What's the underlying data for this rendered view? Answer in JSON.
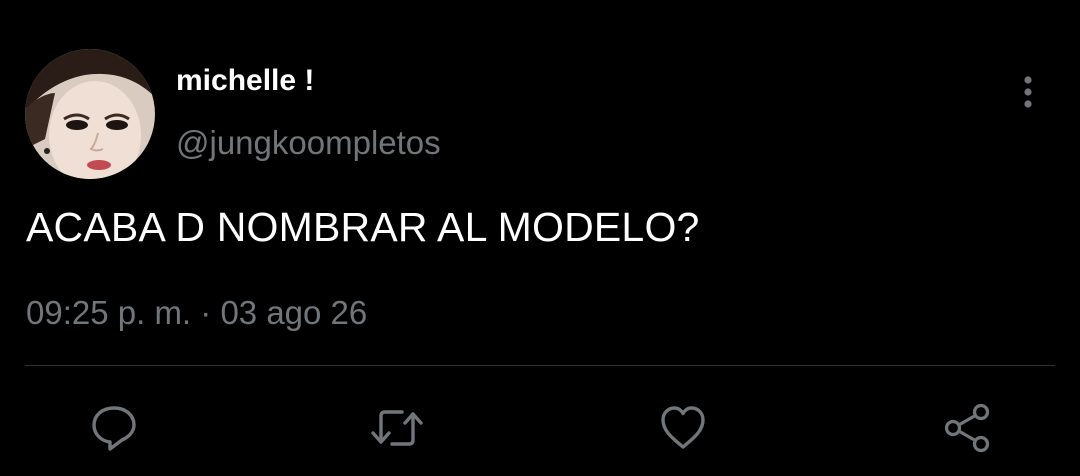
{
  "user": {
    "display_name": "michelle !",
    "handle": "@jungkoompletos"
  },
  "tweet": {
    "text": "ACABA D NOMBRAR AL MODELO?",
    "time": "09:25 p. m.",
    "separator": "·",
    "date": "03 ago 26"
  },
  "actions": [
    {
      "name": "reply",
      "icon": "comment-bubble-icon"
    },
    {
      "name": "retweet",
      "icon": "retweet-icon"
    },
    {
      "name": "like",
      "icon": "heart-icon"
    },
    {
      "name": "share",
      "icon": "share-icon"
    }
  ],
  "colors": {
    "background": "#000000",
    "primary_text": "#ffffff",
    "secondary_text": "#71767b",
    "divider": "#2f3336",
    "icon": "#71767b"
  }
}
